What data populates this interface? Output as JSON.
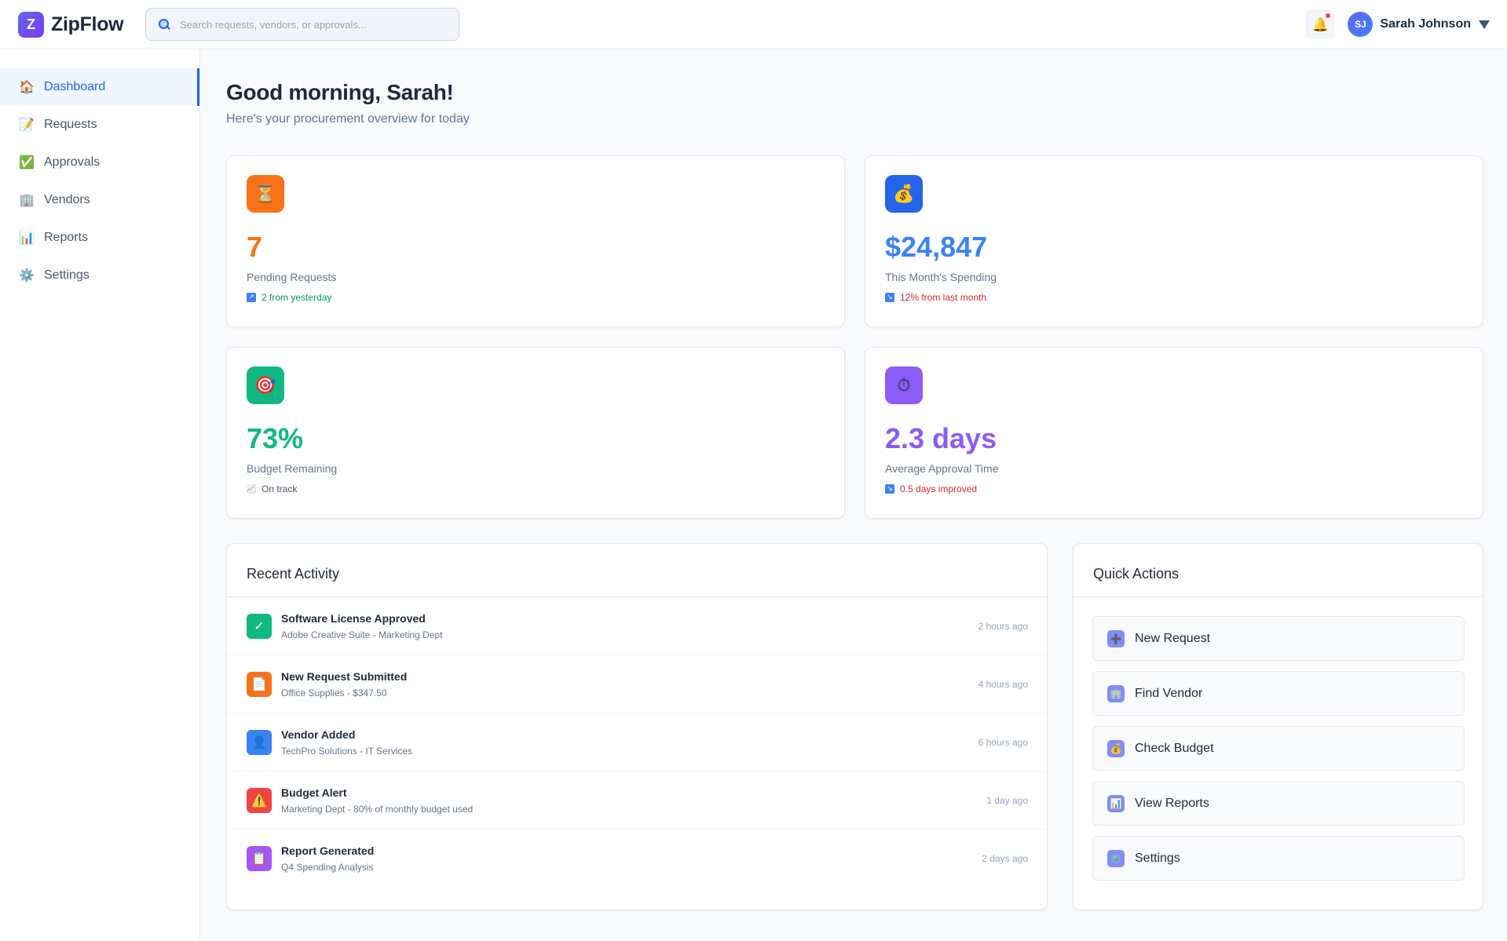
{
  "app": {
    "name": "ZipFlow",
    "logo_letter": "Z"
  },
  "search": {
    "placeholder": "Search requests, vendors, or approvals..."
  },
  "user": {
    "initials": "SJ",
    "name": "Sarah Johnson"
  },
  "sidebar": {
    "items": [
      {
        "label": "Dashboard",
        "icon": "house-icon",
        "glyph": "🏠",
        "active": true
      },
      {
        "label": "Requests",
        "icon": "memo-icon",
        "glyph": "📝",
        "active": false
      },
      {
        "label": "Approvals",
        "icon": "check-box-icon",
        "glyph": "✅",
        "active": false
      },
      {
        "label": "Vendors",
        "icon": "building-icon",
        "glyph": "🏢",
        "active": false
      },
      {
        "label": "Reports",
        "icon": "bar-chart-icon",
        "glyph": "📊",
        "active": false
      },
      {
        "label": "Settings",
        "icon": "gear-icon",
        "glyph": "⚙️",
        "active": false
      }
    ]
  },
  "main": {
    "greeting": "Good morning, Sarah!",
    "subtitle": "Here's your procurement overview for today"
  },
  "stats": [
    {
      "value": "7",
      "label": "Pending Requests",
      "trend": "2 from yesterday",
      "trend_color": "#059669",
      "trend_icon": "chart-up-icon",
      "trend_glyph": "↗",
      "trend_bg": "#3b82f6",
      "icon": "hourglass-icon",
      "glyph": "⏳",
      "icon_bg": "#f97316",
      "value_color": "#f97316"
    },
    {
      "value": "$24,847",
      "label": "This Month's Spending",
      "trend": "12% from last month",
      "trend_color": "#dc2626",
      "trend_icon": "chart-down-icon",
      "trend_glyph": "↘",
      "trend_bg": "#3b82f6",
      "icon": "money-bag-icon",
      "glyph": "💰",
      "icon_bg": "#2563eb",
      "value_color": "#3b82f6"
    },
    {
      "value": "73%",
      "label": "Budget Remaining",
      "trend": "On track",
      "trend_color": "#475569",
      "trend_icon": "chart-icon",
      "trend_glyph": "📈",
      "trend_bg": "#e2e8f0",
      "icon": "target-icon",
      "glyph": "🎯",
      "icon_bg": "#10b981",
      "value_color": "#10b981"
    },
    {
      "value": "2.3 days",
      "label": "Average Approval Time",
      "trend": "0.5 days improved",
      "trend_color": "#dc2626",
      "trend_icon": "chart-down-icon",
      "trend_glyph": "↘",
      "trend_bg": "#3b82f6",
      "icon": "stopwatch-icon",
      "glyph": "⏱",
      "icon_bg": "#8b5cf6",
      "value_color": "#8b5cf6"
    }
  ],
  "activity": {
    "title": "Recent Activity",
    "items": [
      {
        "title": "Software License Approved",
        "subtitle": "Adobe Creative Suite - Marketing Dept",
        "time": "2 hours ago",
        "icon": "check-icon",
        "glyph": "✓",
        "icon_bg": "#10b981"
      },
      {
        "title": "New Request Submitted",
        "subtitle": "Office Supplies - $347.50",
        "time": "4 hours ago",
        "icon": "document-icon",
        "glyph": "📄",
        "icon_bg": "#f97316"
      },
      {
        "title": "Vendor Added",
        "subtitle": "TechPro Solutions - IT Services",
        "time": "6 hours ago",
        "icon": "person-icon",
        "glyph": "👤",
        "icon_bg": "#3b82f6"
      },
      {
        "title": "Budget Alert",
        "subtitle": "Marketing Dept - 80% of monthly budget used",
        "time": "1 day ago",
        "icon": "warning-icon",
        "glyph": "⚠️",
        "icon_bg": "#ef4444"
      },
      {
        "title": "Report Generated",
        "subtitle": "Q4 Spending Analysis",
        "time": "2 days ago",
        "icon": "clipboard-icon",
        "glyph": "📋",
        "icon_bg": "#a855f7"
      }
    ]
  },
  "quick_actions": {
    "title": "Quick Actions",
    "items": [
      {
        "label": "New Request",
        "icon": "plus-icon",
        "glyph": "➕"
      },
      {
        "label": "Find Vendor",
        "icon": "building-icon",
        "glyph": "🏢"
      },
      {
        "label": "Check Budget",
        "icon": "money-bag-icon",
        "glyph": "💰"
      },
      {
        "label": "View Reports",
        "icon": "bar-chart-icon",
        "glyph": "📊"
      },
      {
        "label": "Settings",
        "icon": "gear-icon",
        "glyph": "⚙️"
      }
    ]
  }
}
